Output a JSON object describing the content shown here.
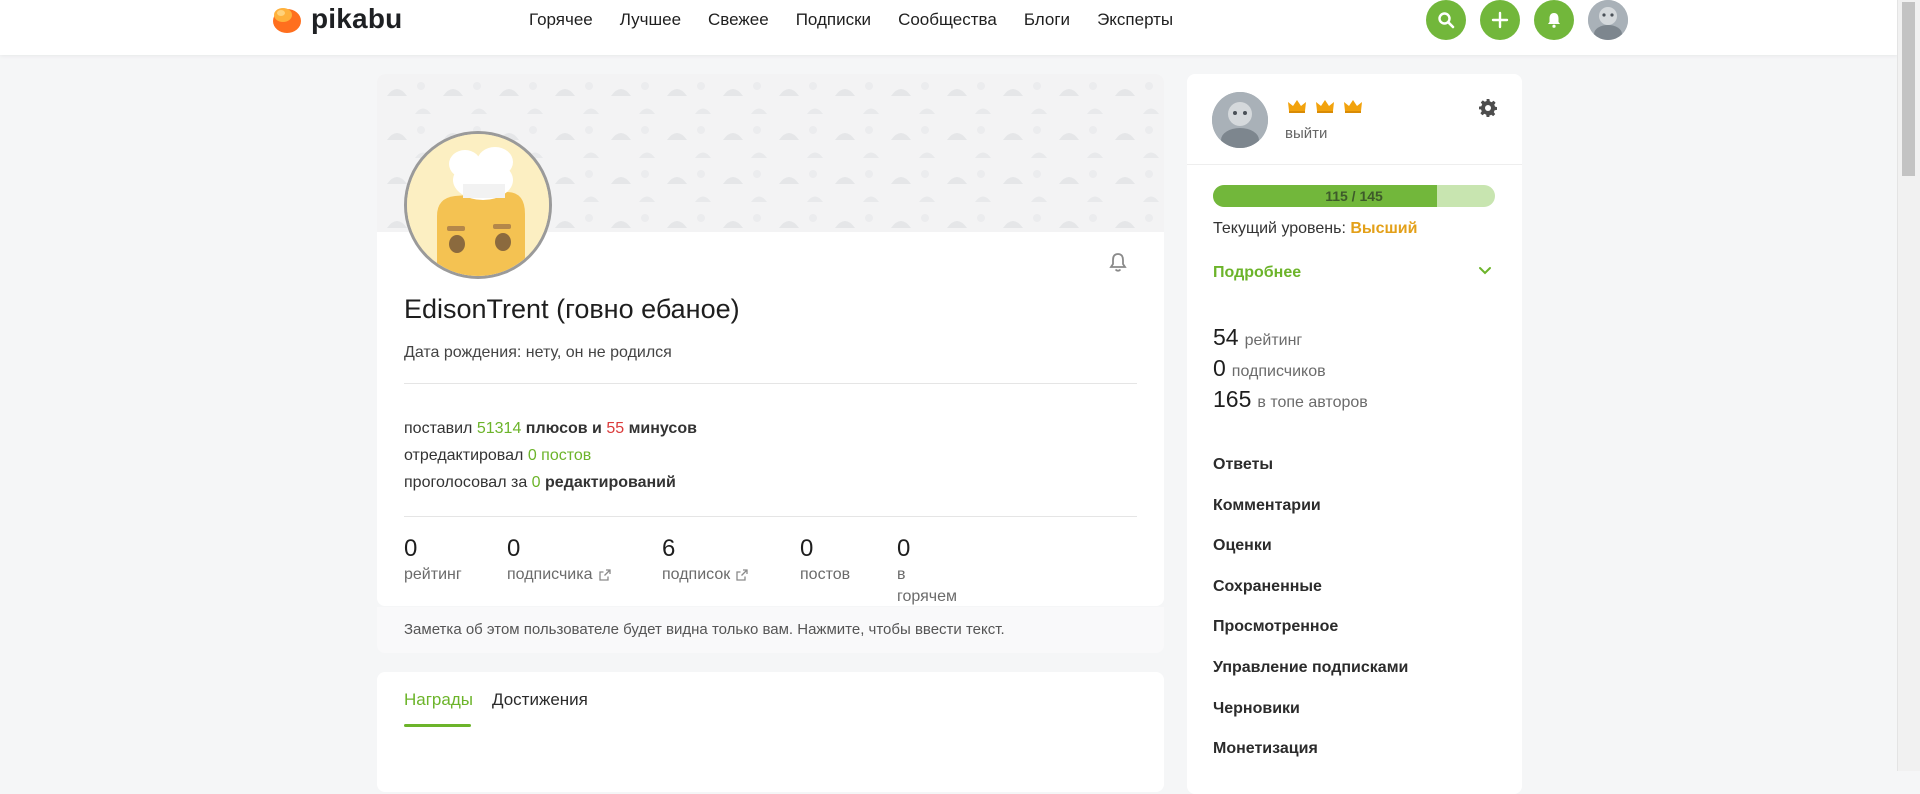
{
  "header": {
    "logo_text": "pikabu",
    "nav": [
      "Горячее",
      "Лучшее",
      "Свежее",
      "Подписки",
      "Сообщества",
      "Блоги",
      "Эксперты"
    ],
    "accent_color": "#72b73b"
  },
  "profile": {
    "name": "EdisonTrent (говно ебаное)",
    "birth": "Дата рождения: нету, он не родился",
    "activity": {
      "line1_prefix": "поставил",
      "pluses": "51314",
      "pluses_word": "плюсов и",
      "minuses": "55",
      "minuses_word": "минусов",
      "line2_prefix": "отредактировал",
      "line2_value": "0 постов",
      "line3_prefix": "проголосовал за",
      "line3_value": "0",
      "line3_word": "редактирований"
    },
    "counters": [
      {
        "value": "0",
        "label": "рейтинг"
      },
      {
        "value": "0",
        "label": "подписчика"
      },
      {
        "value": "6",
        "label": "подписок"
      },
      {
        "value": "0",
        "label": "постов"
      },
      {
        "value": "0",
        "label": "в горячем"
      }
    ],
    "note": "Заметка об этом пользователе будет видна только вам. Нажмите, чтобы ввести текст."
  },
  "tabs": [
    "Награды",
    "Достижения"
  ],
  "sidebar": {
    "logout": "выйти",
    "progress": {
      "text": "115 / 145",
      "current": 115,
      "max": 145
    },
    "level_label": "Текущий уровень:",
    "level_value": "Высший",
    "more": "Подробнее",
    "stats": [
      {
        "value": "54",
        "label": "рейтинг"
      },
      {
        "value": "0",
        "label": "подписчиков"
      },
      {
        "value": "165",
        "label": "в топе авторов"
      }
    ],
    "menu": [
      "Ответы",
      "Комментарии",
      "Оценки",
      "Сохраненные",
      "Просмотренное",
      "Управление подписками",
      "Черновики",
      "Монетизация"
    ]
  }
}
